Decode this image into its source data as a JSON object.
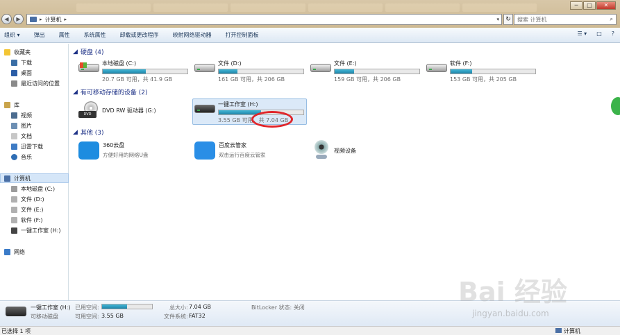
{
  "window": {
    "min": "─",
    "max": "□",
    "close": "✕"
  },
  "address": {
    "computer": "计算机",
    "sep": "▸",
    "dropdown": "▾",
    "refresh": "↻"
  },
  "search": {
    "placeholder": "搜索 计算机",
    "icon": "search-icon"
  },
  "toolbar": {
    "organize": "组织 ▾",
    "eject": "弹出",
    "properties": "属性",
    "system_properties": "系统属性",
    "uninstall": "卸载或更改程序",
    "map_drive": "映射网络驱动器",
    "control_panel": "打开控制面板",
    "view": "☰ ▾",
    "pane": "□",
    "help": "?"
  },
  "sidebar": {
    "favorites": "收藏夹",
    "downloads": "下载",
    "desktop": "桌面",
    "recent": "最近访问的位置",
    "library": "库",
    "videos": "视频",
    "pictures": "图片",
    "documents": "文档",
    "thunder": "迅雷下载",
    "music": "音乐",
    "computer": "计算机",
    "c": "本地磁盘 (C:)",
    "d": "文件 (D:)",
    "e": "文件 (E:)",
    "f": "软件 (F:)",
    "h": "一键工作室 (H:)",
    "network": "网络"
  },
  "sections": {
    "hdd": "硬盘 (4)",
    "removable": "有可移动存储的设备 (2)",
    "other": "其他 (3)"
  },
  "drives": [
    {
      "name": "本地磁盘 (C:)",
      "free": "20.7 GB 可用，共 41.9 GB",
      "used_fraction": 0.51
    },
    {
      "name": "文件 (D:)",
      "free": "161 GB 可用，共 206 GB",
      "used_fraction": 0.22
    },
    {
      "name": "文件 (E:)",
      "free": "159 GB 可用，共 206 GB",
      "used_fraction": 0.23
    },
    {
      "name": "软件 (F:)",
      "free": "153 GB 可用，共 205 GB",
      "used_fraction": 0.25
    }
  ],
  "removable": {
    "dvd": "DVD RW 驱动器 (G:)",
    "usb_name": "一键工作室 (H:)",
    "usb_free": "3.55 GB 可用",
    "usb_total": "共 7.04 GB",
    "usb_used_fraction": 0.5
  },
  "others": [
    {
      "name": "360云盘",
      "desc": "方便好用的网络U盘"
    },
    {
      "name": "百度云管家",
      "desc": "双击运行百度云管家"
    },
    {
      "name": "视频设备",
      "desc": ""
    }
  ],
  "status": {
    "name": "一键工作室 (H:)",
    "type": "可移动磁盘",
    "used_label": "已用空间:",
    "free_label": "可用空间:",
    "free_value": "3.55 GB",
    "total_label": "总大小:",
    "total_value": "7.04 GB",
    "fs_label": "文件系统:",
    "fs_value": "FAT32",
    "bitlocker": "BitLocker 状态: 关闭",
    "used_fraction": 0.5
  },
  "footer": {
    "selected": "已选择 1 项",
    "computer": "计算机"
  },
  "watermark": {
    "brand": "Bai 经验",
    "url": "jingyan.baidu.com"
  }
}
